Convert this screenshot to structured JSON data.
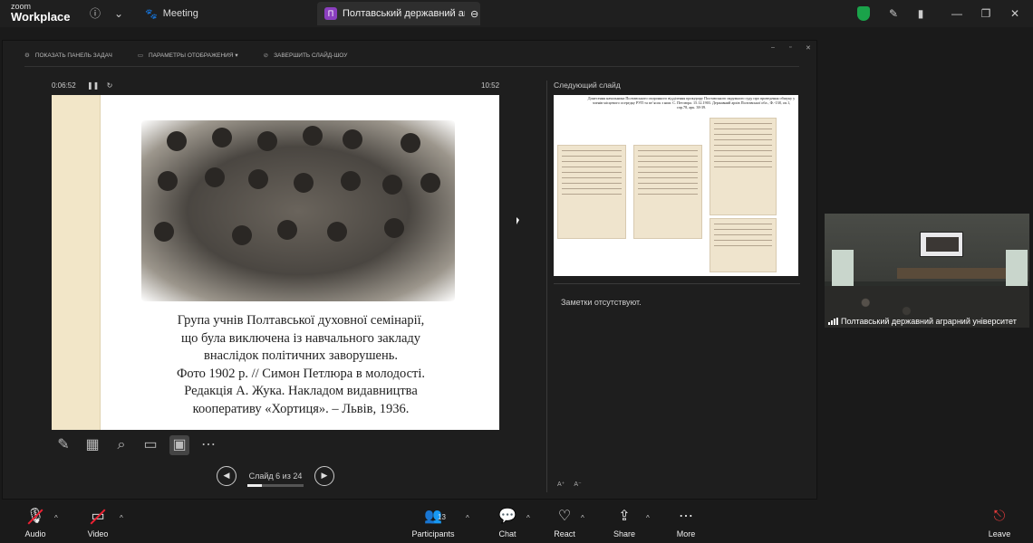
{
  "app": {
    "brand_line1": "zoom",
    "brand_line2": "Workplace"
  },
  "tabs": {
    "meeting_label": "Meeting",
    "active_badge": "П",
    "active_label": "Полтавський державний аграрни"
  },
  "share_toolbar": {
    "show_taskbar": "ПОКАЗАТЬ ПАНЕЛЬ ЗАДАЧ",
    "display_settings": "ПАРАМЕТРЫ ОТОБРАЖЕНИЯ ▾",
    "end_slideshow": "ЗАВЕРШИТЬ СЛАЙД-ШОУ"
  },
  "presenter": {
    "timer": "0:06:52",
    "clock": "10:52",
    "slide_caption": [
      "Група учнів Полтавської духовної семінарії,",
      "що була виключена із навчального закладу",
      "внаслідок політичних заворушень.",
      "Фото 1902 р. // Симон Петлюра в молодості.",
      "Редакція А. Жука. Накладом видавництва",
      "кооперативу «Хортиця». – Львів, 1936."
    ],
    "slide_counter": "Слайд 6 из 24",
    "slide_current": 6,
    "slide_total": 24,
    "next_slide_label": "Следующий слайд",
    "next_slide_text": "Донесення начальника Полтавського охоронного відділення прокурору Полтавського окружного суду про проведення обшуку у членів місцевого осередку РУП та пе`ясок з ним. С. Петлюра. 15.12.1903. Державний архів Полтавської обл., Ф.-138, оп.1, спр.78, арк. 38-39.",
    "notes_text": "Заметки отсутствуют."
  },
  "video_tile": {
    "name": "Полтавський державний аграрний університет"
  },
  "bottom_bar": {
    "audio": "Audio",
    "video": "Video",
    "participants": "Participants",
    "participants_count": "13",
    "chat": "Chat",
    "react": "React",
    "share": "Share",
    "more": "More",
    "leave": "Leave"
  },
  "colors": {
    "shield": "#1aa34a",
    "leave": "#e23b3b",
    "tab_badge": "#8b3fbf"
  }
}
